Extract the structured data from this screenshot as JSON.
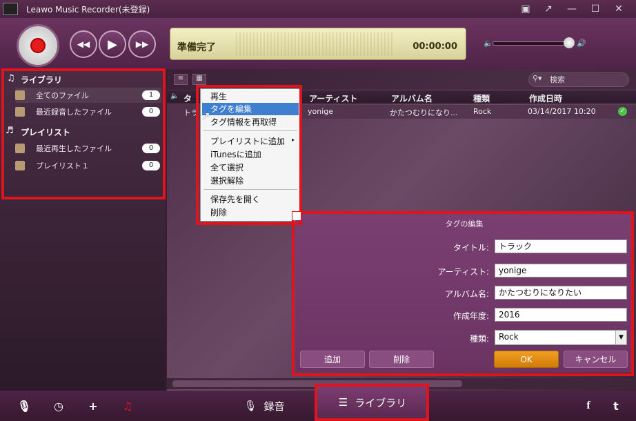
{
  "app": {
    "title": "Leawo Music Recorder(未登録)"
  },
  "window": {
    "buttons": [
      "▣",
      "↗",
      "—",
      "☐",
      "✕"
    ]
  },
  "player": {
    "status": "準備完了",
    "time": "00:00:00",
    "volume_percent": 90
  },
  "sidebar": {
    "library_header": "ライブラリ",
    "library_items": [
      {
        "label": "全てのファイル",
        "count": "1"
      },
      {
        "label": "最近録音したファイル",
        "count": "0"
      }
    ],
    "playlist_header": "プレイリスト",
    "playlist_items": [
      {
        "label": "最近再生したファイル",
        "count": "0"
      },
      {
        "label": "プレイリスト１",
        "count": "0"
      }
    ]
  },
  "search": {
    "placeholder": "検索"
  },
  "table": {
    "columns": [
      "タ",
      "アーティスト",
      "アルバム名",
      "種類",
      "作成日時"
    ],
    "rows": [
      {
        "title": "トラ",
        "artist": "yonige",
        "album": "かたつむりになり...",
        "genre": "Rock",
        "date": "03/14/2017 10:20"
      }
    ]
  },
  "context_menu": {
    "items": [
      "再生",
      "タグを編集",
      "タグ情報を再取得",
      "プレイリストに追加",
      "iTunesに追加",
      "全て選択",
      "選択解除",
      "保存先を開く",
      "削除"
    ],
    "selected_index": 1
  },
  "tag_dialog": {
    "title": "タグの編集",
    "labels": {
      "title": "タイトル:",
      "artist": "アーティスト:",
      "album": "アルバム名:",
      "year": "作成年度:",
      "genre": "種類:"
    },
    "values": {
      "title": "トラック",
      "artist": "yonige",
      "album": "かたつむりになりたい",
      "year": "2016",
      "genre": "Rock"
    },
    "buttons": {
      "add": "追加",
      "delete": "削除",
      "ok": "OK",
      "cancel": "キャンセル"
    }
  },
  "bottom": {
    "tab_record": "録音",
    "tab_library": "ライブラリ"
  },
  "colors": {
    "accent": "#e0141c",
    "ok_button": "#e08a10",
    "theme": "#6a3462"
  }
}
